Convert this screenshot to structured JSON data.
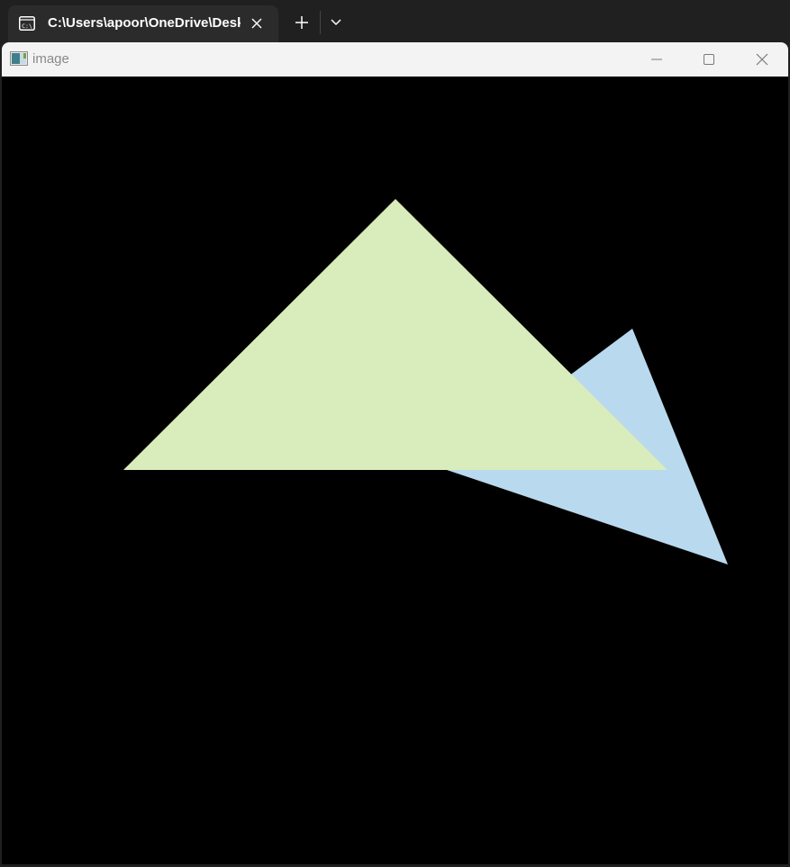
{
  "terminal_tab": {
    "title": "C:\\Users\\apoor\\OneDrive\\Desktop",
    "icon": "console-icon"
  },
  "tab_actions": {
    "new_tab_icon": "plus-icon",
    "dropdown_icon": "chevron-down-icon"
  },
  "window": {
    "title": "image",
    "icon": "image-window-icon",
    "controls": [
      "minimize-icon",
      "maximize-icon",
      "close-icon"
    ]
  },
  "scene": {
    "background": "#000000",
    "triangles": [
      {
        "name": "blue-triangle",
        "color": "#b9d9ee"
      },
      {
        "name": "green-triangle",
        "color": "#d9ecbb"
      }
    ]
  }
}
